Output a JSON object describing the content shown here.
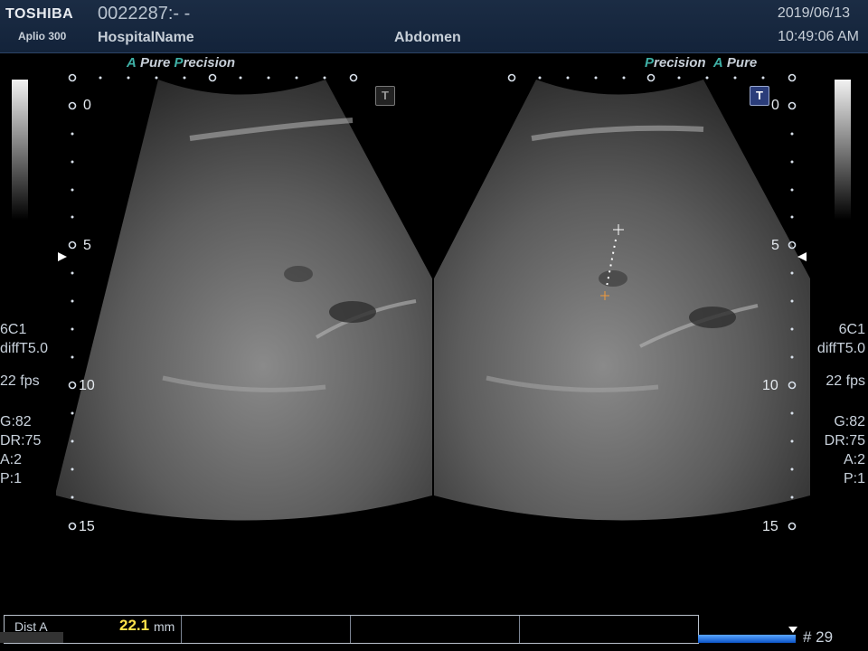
{
  "header": {
    "brand": "TOSHIBA",
    "model": "Aplio 300",
    "patient_id": "0022287:- -",
    "hospital": "HospitalName",
    "exam": "Abdomen",
    "date": "2019/06/13",
    "time": "10:49:06 AM"
  },
  "left_panel": {
    "tag_a": "A",
    "tag_pure": "Pure",
    "tag_p": "P",
    "tag_recision": "recision",
    "depth_labels": [
      "0",
      "5",
      "10",
      "15"
    ],
    "probe": "6C1",
    "mode": "diffT5.0",
    "fps": "22 fps",
    "gain": "G:82",
    "dynamic_range": "DR:75",
    "a_value": "A:2",
    "p_value": "P:1",
    "t_icon": "T"
  },
  "right_panel": {
    "tag_p": "P",
    "tag_recision": "recision",
    "tag_a": "A",
    "tag_pure": "Pure",
    "depth_labels": [
      "0",
      "5",
      "10",
      "15"
    ],
    "probe": "6C1",
    "mode": "diffT5.0",
    "fps": "22 fps",
    "gain": "G:82",
    "dynamic_range": "DR:75",
    "a_value": "A:2",
    "p_value": "P:1",
    "t_icon": "T"
  },
  "measurement": {
    "label": "Dist A",
    "value": "22.1",
    "unit": "mm"
  },
  "cine": {
    "frame": "# 29",
    "progress": 1.0
  },
  "colors": {
    "header_bg": "#172840",
    "accent_teal": "#3fb0a6",
    "measure_value": "#ffe24a",
    "cine_bar": "#1e6fe0"
  }
}
